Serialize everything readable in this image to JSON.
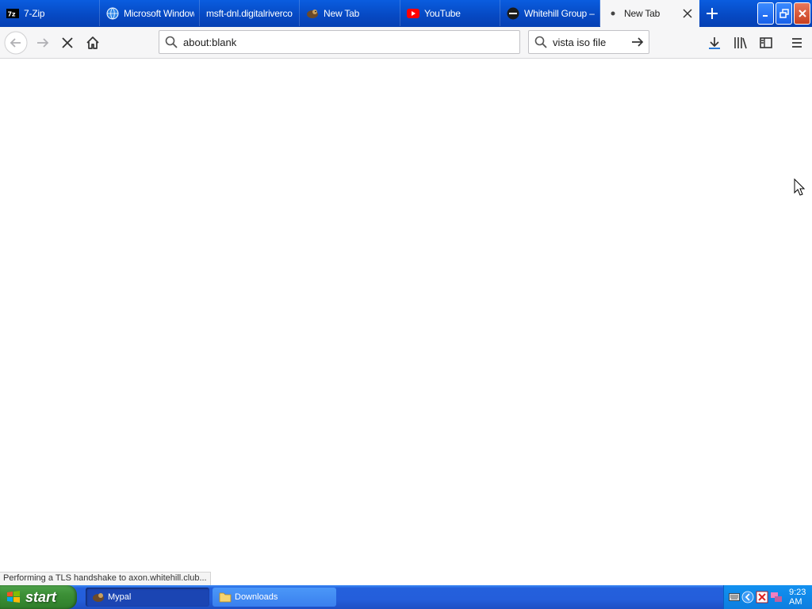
{
  "browser": {
    "tabs": [
      {
        "label": "7-Zip",
        "icon": "7zip-icon"
      },
      {
        "label": "Microsoft Window",
        "icon": "globe-icon"
      },
      {
        "label": "msft-dnl.digitalriverco",
        "icon": "none"
      },
      {
        "label": "New Tab",
        "icon": "mypal-icon"
      },
      {
        "label": "YouTube",
        "icon": "youtube-icon"
      },
      {
        "label": "Whitehill Group –",
        "icon": "whitehill-icon"
      },
      {
        "label": "New Tab",
        "icon": "loading-dot-icon",
        "active": true
      }
    ],
    "address": "about:blank",
    "search": "vista iso file",
    "status": "Performing a TLS handshake to axon.whitehill.club..."
  },
  "taskbar": {
    "start_label": "start",
    "items": [
      {
        "label": "Mypal",
        "icon": "mypal-icon",
        "pressed": true
      },
      {
        "label": "Downloads",
        "icon": "folder-icon",
        "pressed": false
      }
    ],
    "clock": "9:23 AM"
  },
  "colors": {
    "titlebar": "#0648c2",
    "toolbar": "#f6f6f7",
    "taskbar": "#245edb",
    "start": "#3c8f36",
    "tray": "#0d7ee0"
  }
}
